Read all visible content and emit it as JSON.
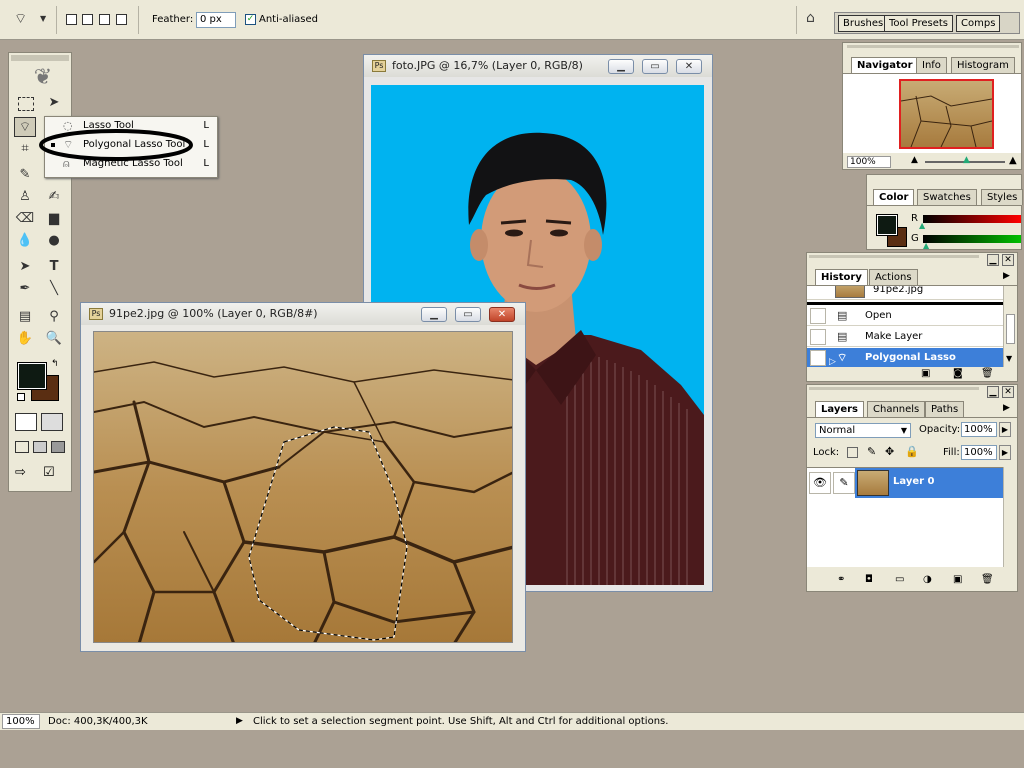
{
  "options_bar": {
    "feather_label": "Feather:",
    "feather_value": "0 px",
    "antialiased_label": "Anti-aliased",
    "antialiased_checked": true,
    "palette_well": {
      "brushes": "Brushes",
      "tool_presets": "Tool Presets",
      "comps": "Comps"
    }
  },
  "tool_flyout": {
    "items": [
      {
        "label": "Lasso Tool",
        "key": "L"
      },
      {
        "label": "Polygonal Lasso Tool",
        "key": "L"
      },
      {
        "label": "Magnetic Lasso Tool",
        "key": "L"
      }
    ]
  },
  "windows": {
    "foto": {
      "title": "foto.JPG @ 16,7% (Layer 0, RGB/8)",
      "canvas_bg": "#00b3f0"
    },
    "cracked": {
      "title": "91pe2.jpg @ 100% (Layer 0, RGB/8#)"
    }
  },
  "navigator_panel": {
    "tabs": [
      "Navigator",
      "Info",
      "Histogram"
    ],
    "zoom": "100%"
  },
  "color_panel": {
    "tabs": [
      "Color",
      "Swatches",
      "Styles"
    ],
    "r_label": "R",
    "g_label": "G"
  },
  "history_panel": {
    "tabs": [
      "History",
      "Actions"
    ],
    "snapshot": "91pe2.jpg",
    "items": [
      "Open",
      "Make Layer",
      "Polygonal Lasso"
    ]
  },
  "layers_panel": {
    "tabs": [
      "Layers",
      "Channels",
      "Paths"
    ],
    "blend_mode": "Normal",
    "opacity_label": "Opacity:",
    "opacity": "100%",
    "lock_label": "Lock:",
    "fill_label": "Fill:",
    "fill": "100%",
    "layers": [
      {
        "name": "Layer 0"
      }
    ]
  },
  "status_bar": {
    "zoom": "100%",
    "doc": "Doc: 400,3K/400,3K",
    "hint": "Click to set a selection segment point.  Use Shift, Alt and Ctrl for additional options."
  },
  "colors": {
    "foreground": "#0e1a12",
    "background": "#5a2e12",
    "workspace": "#aba194",
    "selection_blue": "#3d7fd9",
    "photo_bg_blue": "#00b3f0"
  }
}
